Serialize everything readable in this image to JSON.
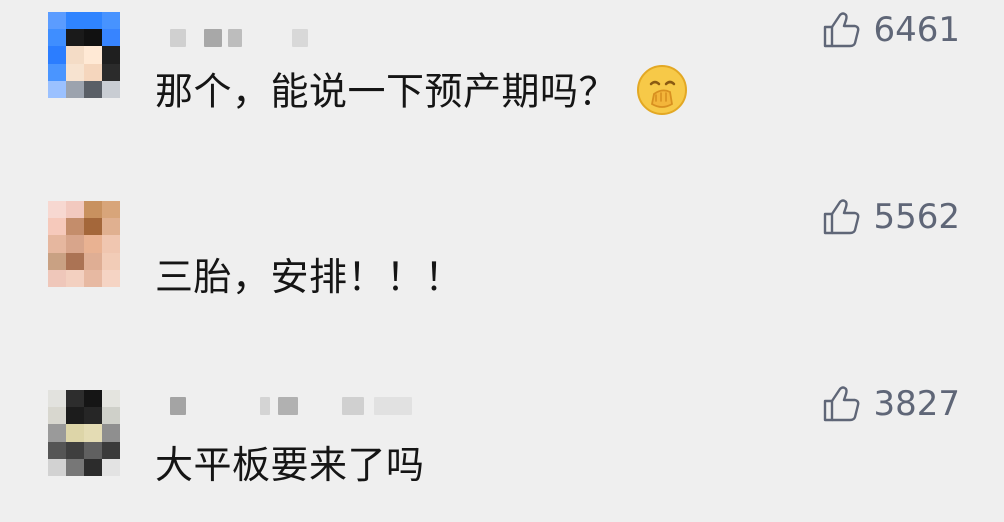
{
  "comments": [
    {
      "text": "那个，能说一下预产期吗？",
      "likes": "6461",
      "has_emoji": true,
      "emoji_icon": "hand-over-mouth-emoji-icon"
    },
    {
      "text": "三胎，安排！！！",
      "likes": "5562",
      "has_emoji": false
    },
    {
      "text": "大平板要来了吗",
      "likes": "3827",
      "has_emoji": false
    }
  ],
  "icons": {
    "like": "thumbs-up-icon"
  },
  "colors": {
    "background": "#efefef",
    "text": "#151515",
    "like": "#5f6677",
    "emoji": "#f7c948"
  }
}
